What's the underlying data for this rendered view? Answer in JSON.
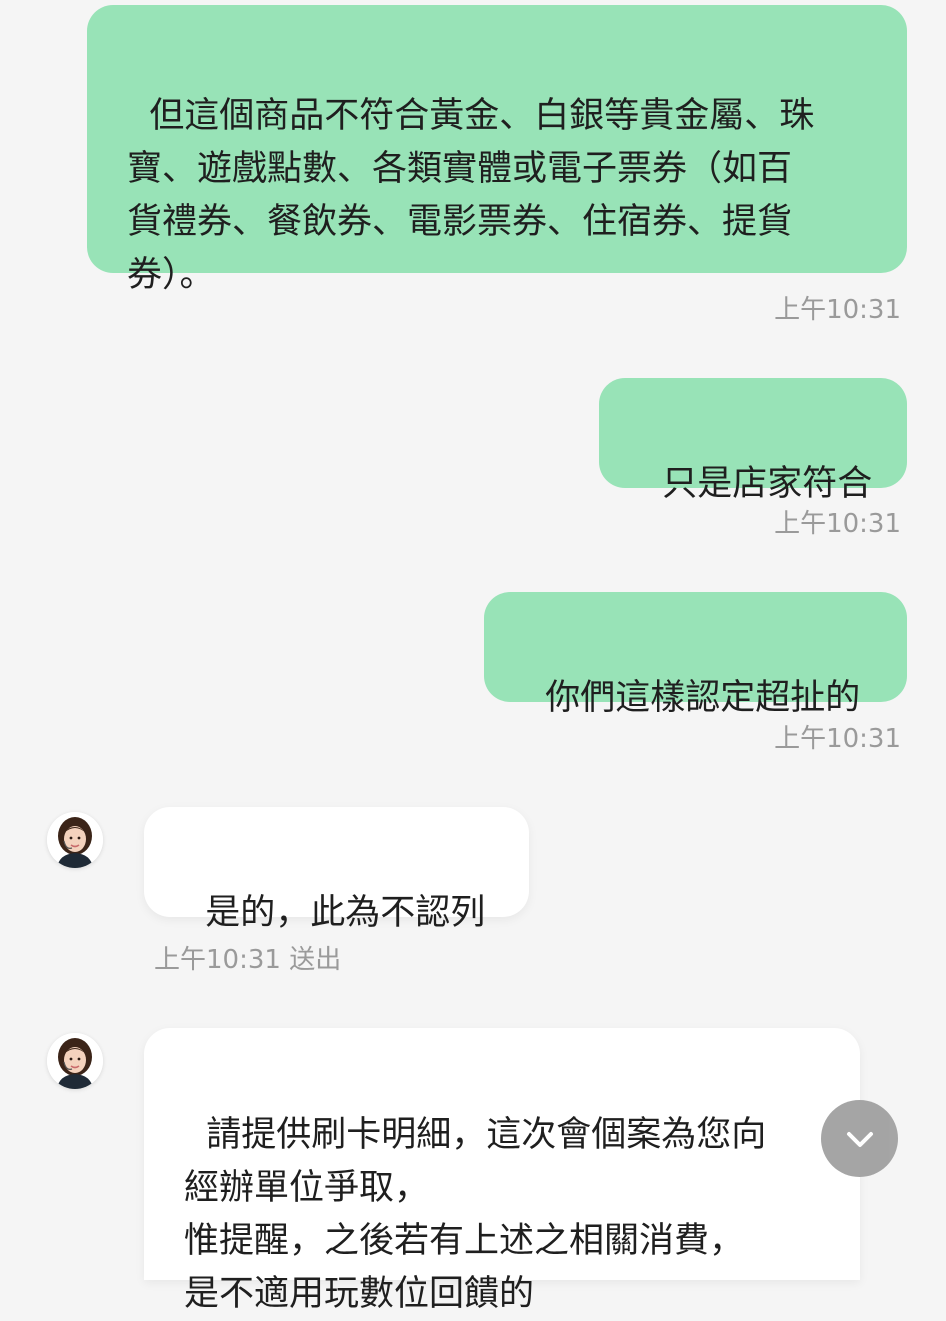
{
  "messages": [
    {
      "sender": "user",
      "text": "但這個商品不符合黃金、白銀等貴金屬、珠\n寶、遊戲點數、各類實體或電子票券（如百\n貨禮券、餐飲券、電影票券、住宿券、提貨\n券）。",
      "time": "上午10:31"
    },
    {
      "sender": "user",
      "text": "只是店家符合",
      "time": "上午10:31"
    },
    {
      "sender": "user",
      "text": "你們這樣認定超扯的",
      "time": "上午10:31"
    },
    {
      "sender": "agent",
      "text": "是的，此為不認列",
      "time": "上午10:31 送出"
    },
    {
      "sender": "agent",
      "text": "請提供刷卡明細，這次會個案為您向\n經辦單位爭取，\n惟提醒，之後若有上述之相關消費，\n是不適用玩數位回饋的"
    }
  ],
  "icons": {
    "avatar": "agent-avatar-icon",
    "scroll_down": "chevron-down-icon"
  },
  "colors": {
    "background": "#f5f5f5",
    "user_bubble": "#98e3b7",
    "agent_bubble": "#ffffff",
    "timestamp": "#9a9a9a",
    "scroll_button": "#9e9e9e"
  }
}
